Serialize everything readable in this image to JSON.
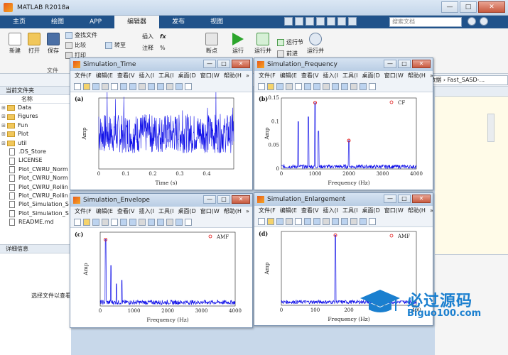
{
  "window": {
    "title": "MATLAB R2018a",
    "min": "—",
    "max": "□",
    "close": "✕"
  },
  "ribbon_tabs": [
    "主页",
    "绘图",
    "APP",
    "编辑器",
    "发布",
    "视图"
  ],
  "search_placeholder": "搜索文档",
  "ribbon": {
    "new": "新建",
    "open": "打开",
    "save": "保存",
    "find_files": "查找文件",
    "compare": "比较",
    "print": "打印",
    "goto": "转至",
    "find": "查找",
    "insert": "插入",
    "comment": "注释",
    "indent": "缩进",
    "breakpoint": "断点",
    "run": "运行",
    "run_advance": "运行并",
    "run_section": "运行节",
    "advance": "前进",
    "run_time": "运行并",
    "file_group": "文件"
  },
  "address_path": "n › 数据 › Fast_SASD-...",
  "current_folder": {
    "header": "当前文件夹",
    "col_name": "名称",
    "items": [
      {
        "name": "Data",
        "type": "folder"
      },
      {
        "name": "Figures",
        "type": "folder"
      },
      {
        "name": "Fun",
        "type": "folder"
      },
      {
        "name": "Plot",
        "type": "folder"
      },
      {
        "name": "util",
        "type": "folder"
      },
      {
        "name": ".DS_Store",
        "type": "file"
      },
      {
        "name": "LICENSE",
        "type": "file"
      },
      {
        "name": "Plot_CWRU_Norm",
        "type": "file"
      },
      {
        "name": "Plot_CWRU_Norm",
        "type": "file"
      },
      {
        "name": "Plot_CWRU_Rollin",
        "type": "file"
      },
      {
        "name": "Plot_CWRU_Rollin",
        "type": "file"
      },
      {
        "name": "Plot_Simulation_S",
        "type": "file"
      },
      {
        "name": "Plot_Simulation_S",
        "type": "file"
      },
      {
        "name": "README.md",
        "type": "file"
      }
    ]
  },
  "details": {
    "header": "详细信息",
    "hint": "选择文件以查看"
  },
  "figure_menu": [
    "文件(F",
    "编辑(E",
    "查看(V",
    "插入(I",
    "工具(I",
    "桌面(D",
    "窗口(W",
    "帮助(H"
  ],
  "figures": {
    "time": {
      "title": "Simulation_Time",
      "panel": "(a)",
      "xlabel": "Time (s)",
      "ylabel": "Amp",
      "xticks": [
        "0",
        "0.1",
        "0.2",
        "0.3",
        "0.4"
      ]
    },
    "freq": {
      "title": "Simulation_Frequency",
      "panel": "(b)",
      "xlabel": "Frequency (Hz)",
      "ylabel": "Amp",
      "legend": "CF",
      "xticks": [
        "0",
        "1000",
        "2000",
        "3000",
        "4000"
      ],
      "yticks": [
        "0",
        "0.05",
        "0.1",
        "0.15"
      ]
    },
    "env": {
      "title": "Simulation_Envelope",
      "panel": "(c)",
      "xlabel": "Frequency (Hz)",
      "ylabel": "Amp",
      "legend": "AMF",
      "xticks": [
        "0",
        "1000",
        "2000",
        "3000",
        "4000"
      ]
    },
    "enl": {
      "title": "Simulation_Enlargement",
      "panel": "(d)",
      "xlabel": "Frequency (Hz)",
      "ylabel": "Amp",
      "legend": "AMF",
      "xticks": [
        "0",
        "100",
        "200",
        "300",
        "400"
      ]
    }
  },
  "watermark": {
    "cn": "必过源码",
    "url": "Biguo100.com"
  },
  "chart_data": [
    {
      "type": "line",
      "panel": "(a)",
      "xlabel": "Time (s)",
      "ylabel": "Amp",
      "xlim": [
        0,
        0.5
      ],
      "note": "dense noisy vibration signal around 0"
    },
    {
      "type": "line",
      "panel": "(b)",
      "xlabel": "Frequency (Hz)",
      "ylabel": "Amp",
      "xlim": [
        0,
        4000
      ],
      "ylim": [
        0,
        0.15
      ],
      "peaks": [
        {
          "x": 1000,
          "y": 0.14
        },
        {
          "x": 2000,
          "y": 0.06
        },
        {
          "x": 500,
          "y": 0.1
        },
        {
          "x": 800,
          "y": 0.11
        },
        {
          "x": 1100,
          "y": 0.08
        }
      ],
      "markers": [
        {
          "x": 1000,
          "y": 0.14
        },
        {
          "x": 2000,
          "y": 0.06
        }
      ],
      "legend": "CF"
    },
    {
      "type": "line",
      "panel": "(c)",
      "xlabel": "Frequency (Hz)",
      "ylabel": "Amp",
      "xlim": [
        0,
        4000
      ],
      "peaks": [
        {
          "x": 160,
          "y": 0.9
        },
        {
          "x": 320,
          "y": 0.55
        },
        {
          "x": 480,
          "y": 0.3
        },
        {
          "x": 640,
          "y": 0.35
        }
      ],
      "markers": [
        {
          "x": 160,
          "y": 0.9
        }
      ],
      "legend": "AMF"
    },
    {
      "type": "line",
      "panel": "(d)",
      "xlabel": "Frequency (Hz)",
      "ylabel": "Amp",
      "xlim": [
        0,
        400
      ],
      "peaks": [
        {
          "x": 160,
          "y": 0.95
        }
      ],
      "markers": [
        {
          "x": 160,
          "y": 0.95
        }
      ],
      "legend": "AMF"
    }
  ]
}
